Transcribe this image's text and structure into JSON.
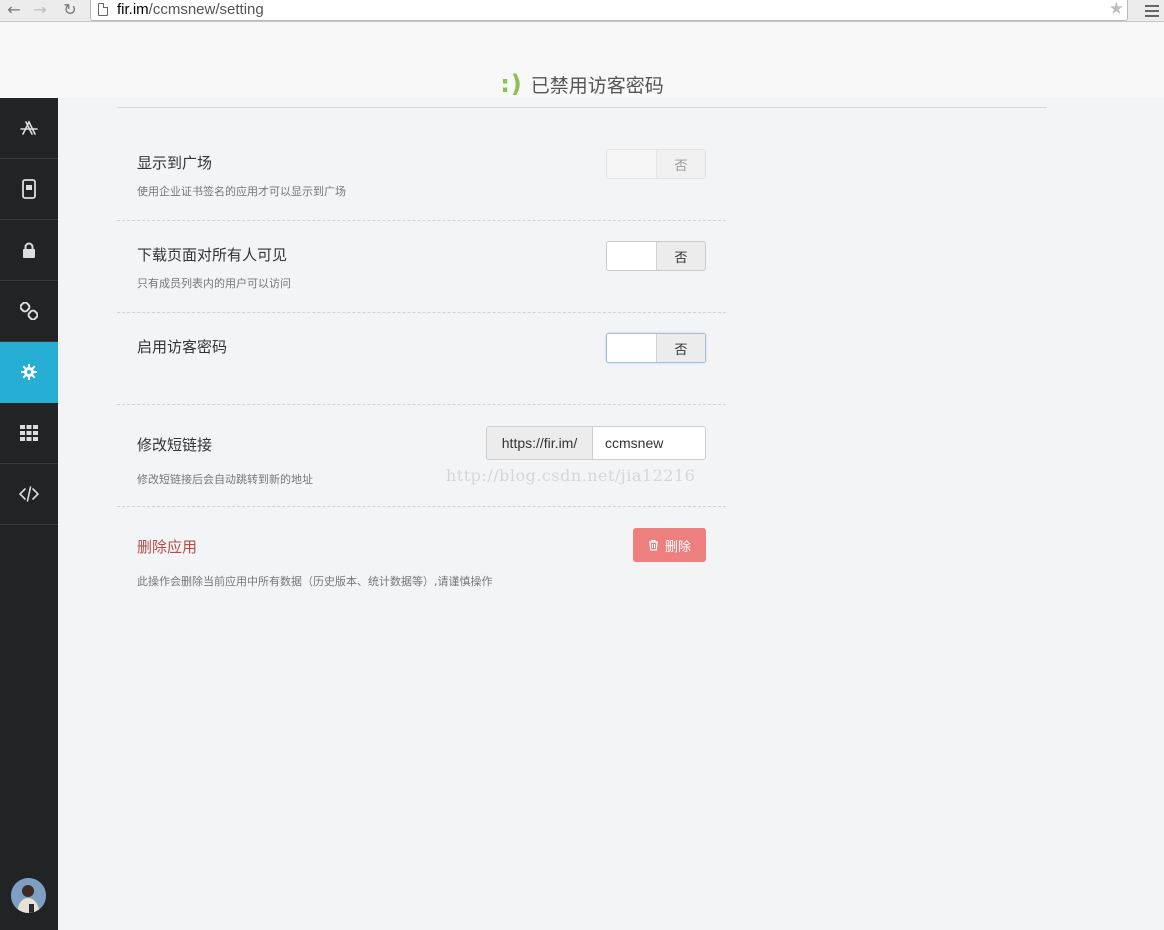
{
  "browser": {
    "url_host": "fir.im",
    "url_path": "/ccmsnew/setting"
  },
  "toast": {
    "icon_text": ":)",
    "message": "已禁用访客密码"
  },
  "sidebar": {
    "items": [
      {
        "icon": "app-store-icon",
        "active": false
      },
      {
        "icon": "device-icon",
        "active": false
      },
      {
        "icon": "lock-icon",
        "active": false
      },
      {
        "icon": "link-icon",
        "active": false
      },
      {
        "icon": "gear-icon",
        "active": true
      },
      {
        "icon": "grid-icon",
        "active": false
      },
      {
        "icon": "code-icon",
        "active": false
      }
    ],
    "active_color": "#26aed4"
  },
  "settings": {
    "show_in_square": {
      "title": "显示到广场",
      "desc": "使用企业证书签名的应用才可以显示到广场",
      "toggle_label": "否"
    },
    "download_visible": {
      "title": "下载页面对所有人可见",
      "desc": "只有成员列表内的用户可以访问",
      "toggle_label": "否"
    },
    "visitor_password": {
      "title": "启用访客密码",
      "toggle_label": "否"
    },
    "short_link": {
      "title": "修改短链接",
      "desc": "修改短链接后会自动跳转到新的地址",
      "prefix": "https://fir.im/",
      "value": "ccmsnew"
    },
    "delete_app": {
      "title": "删除应用",
      "desc": "此操作会删除当前应用中所有数据（历史版本、统计数据等）,请谨慎操作",
      "button_label": "删除"
    }
  },
  "watermark": "http://blog.csdn.net/jia12216",
  "colors": {
    "danger_button": "#ee7f7f",
    "danger_text": "#b94a48",
    "success_icon": "#8cc152"
  }
}
